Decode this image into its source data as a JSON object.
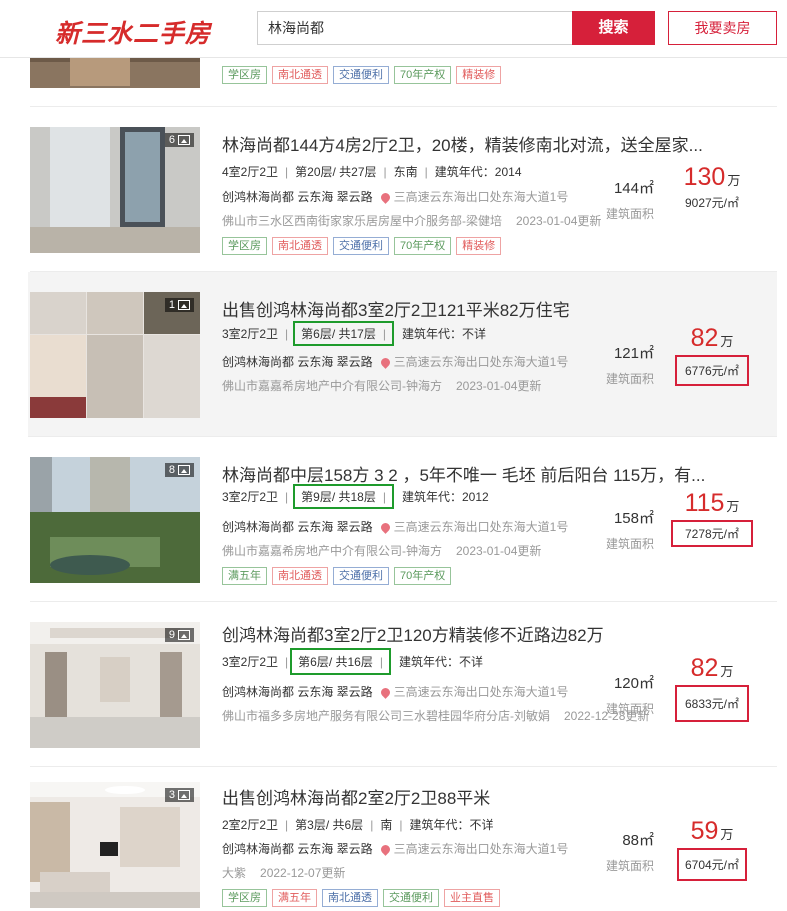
{
  "header": {
    "logo": "新三水二手房",
    "search_value": "林海尚都",
    "search_button": "搜索",
    "sell_button": "我要卖房"
  },
  "partial_listing": {
    "tags": [
      "学区房",
      "南北通透",
      "交通便利",
      "70年产权",
      "精装修"
    ]
  },
  "listings": [
    {
      "photo_count": "6",
      "title": "林海尚都144方4房2厅2卫，20楼，精装修南北对流，送全屋家...",
      "layout": "4室2厅2卫",
      "floor": "第20层/ 共27层",
      "orientation": "东南",
      "year": "建筑年代：2014",
      "community": "创鸿林海尚都 云东海 翠云路",
      "location": "三高速云东海出口处东海大道1号",
      "agent": "佛山市三水区西南街家家乐居房屋中介服务部-梁健培",
      "date": "2023-01-04更新",
      "area": "144㎡",
      "area_label": "建筑面积",
      "price": "130",
      "price_unit": "万",
      "unit_price": "9027元/㎡",
      "tags": [
        {
          "text": "学区房",
          "color": "green"
        },
        {
          "text": "南北通透",
          "color": "red"
        },
        {
          "text": "交通便利",
          "color": "blue"
        },
        {
          "text": "70年产权",
          "color": "green"
        },
        {
          "text": "精装修",
          "color": "red"
        }
      ]
    },
    {
      "photo_count": "1",
      "title": "出售创鸿林海尚都3室2厅2卫121平米82万住宅",
      "layout": "3室2厅2卫",
      "floor": "第6层/ 共17层",
      "year": "建筑年代：不详",
      "community": "创鸿林海尚都 云东海 翠云路",
      "location": "三高速云东海出口处东海大道1号",
      "agent": "佛山市嘉嘉希房地产中介有限公司-钟海方",
      "date": "2023-01-04更新",
      "area": "121㎡",
      "area_label": "建筑面积",
      "price": "82",
      "price_unit": "万",
      "unit_price": "6776元/㎡"
    },
    {
      "photo_count": "8",
      "title": "林海尚都中层158方 3 2 ，5年不唯一 毛坯 前后阳台 115万，有...",
      "layout": "3室2厅2卫",
      "floor": "第9层/ 共18层",
      "year": "建筑年代：2012",
      "community": "创鸿林海尚都 云东海 翠云路",
      "location": "三高速云东海出口处东海大道1号",
      "agent": "佛山市嘉嘉希房地产中介有限公司-钟海方",
      "date": "2023-01-04更新",
      "area": "158㎡",
      "area_label": "建筑面积",
      "price": "115",
      "price_unit": "万",
      "unit_price": "7278元/㎡",
      "tags": [
        {
          "text": "满五年",
          "color": "green"
        },
        {
          "text": "南北通透",
          "color": "red"
        },
        {
          "text": "交通便利",
          "color": "blue"
        },
        {
          "text": "70年产权",
          "color": "green"
        }
      ]
    },
    {
      "photo_count": "9",
      "title": "创鸿林海尚都3室2厅2卫120方精装修不近路边82万",
      "layout": "3室2厅2卫",
      "floor": "第6层/ 共16层",
      "year": "建筑年代：不详",
      "community": "创鸿林海尚都 云东海 翠云路",
      "location": "三高速云东海出口处东海大道1号",
      "agent": "佛山市福多多房地产服务有限公司三水碧桂园华府分店-刘敏娟",
      "date": "2022-12-28更新",
      "area": "120㎡",
      "area_label": "建筑面积",
      "price": "82",
      "price_unit": "万",
      "unit_price": "6833元/㎡"
    },
    {
      "photo_count": "3",
      "title": "出售创鸿林海尚都2室2厅2卫88平米",
      "layout": "2室2厅2卫",
      "floor": "第3层/ 共6层",
      "orientation": "南",
      "year": "建筑年代：不详",
      "community": "创鸿林海尚都 云东海 翠云路",
      "location": "三高速云东海出口处东海大道1号",
      "agent": "大紫",
      "date": "2022-12-07更新",
      "area": "88㎡",
      "area_label": "建筑面积",
      "price": "59",
      "price_unit": "万",
      "unit_price": "6704元/㎡",
      "tags": [
        {
          "text": "学区房",
          "color": "green"
        },
        {
          "text": "满五年",
          "color": "red"
        },
        {
          "text": "南北通透",
          "color": "blue"
        },
        {
          "text": "交通便利",
          "color": "green"
        },
        {
          "text": "业主直售",
          "color": "red"
        }
      ]
    }
  ],
  "colors": {
    "accent": "#d6203a",
    "price": "#d62b2b",
    "highlight_green": "#1e9b2c"
  }
}
